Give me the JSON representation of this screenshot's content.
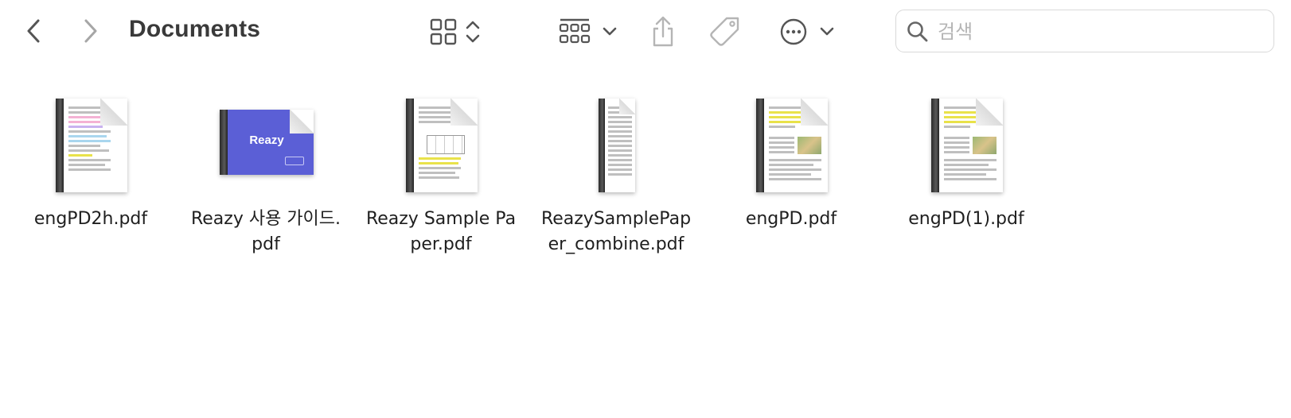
{
  "toolbar": {
    "title": "Documents",
    "search_placeholder": "검색",
    "icons": [
      "chevron-left-icon",
      "chevron-right-icon",
      "icon-view-grid-icon",
      "up-down-chevron-icon",
      "group-grid-icon",
      "chevron-down-icon",
      "share-icon",
      "tag-icon",
      "more-ellipsis-icon",
      "chevron-down-icon",
      "search-icon"
    ]
  },
  "files": [
    {
      "name": "engPD2h.pdf",
      "thumb": "pdf-highlighted"
    },
    {
      "name": "Reazy 사용 가이드.pdf",
      "thumb": "pdf-cover-blue",
      "cover_text": "Reazy"
    },
    {
      "name": "Reazy Sample Paper.pdf",
      "thumb": "pdf-table"
    },
    {
      "name": "ReazySamplePaper_combine.pdf",
      "thumb": "pdf-narrow"
    },
    {
      "name": "engPD.pdf",
      "thumb": "pdf-yellow"
    },
    {
      "name": "engPD(1).pdf",
      "thumb": "pdf-yellow"
    }
  ],
  "colors": {
    "cover_blue": "#5b5fd6",
    "highlight_yellow": "#e9e24a",
    "highlight_pink": "#f4b2d4",
    "highlight_blue": "#a9d6ee"
  }
}
